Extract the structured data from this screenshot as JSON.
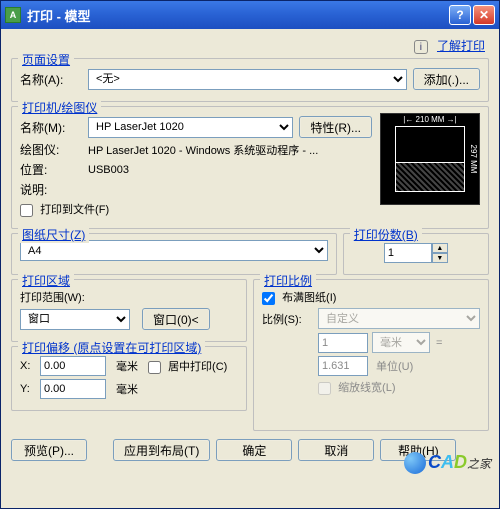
{
  "window": {
    "title": "打印 - 模型"
  },
  "help": {
    "info_icon": "i",
    "link": "了解打印"
  },
  "page_setup": {
    "legend": "页面设置",
    "name_label": "名称(A):",
    "name_value": "<无>",
    "add_btn": "添加(.)..."
  },
  "printer": {
    "legend": "打印机/绘图仪",
    "name_label": "名称(M):",
    "name_value": "HP LaserJet 1020",
    "props_btn": "特性(R)...",
    "plotter_label": "绘图仪:",
    "plotter_value": "HP LaserJet 1020 - Windows 系统驱动程序 - ...",
    "where_label": "位置:",
    "where_value": "USB003",
    "desc_label": "说明:",
    "desc_value": "",
    "print_to_file": "打印到文件(F)",
    "preview": {
      "width": "210 MM",
      "height": "297 MM"
    }
  },
  "paper": {
    "legend": "图纸尺寸(Z)",
    "value": "A4"
  },
  "copies": {
    "legend": "打印份数(B)",
    "value": "1"
  },
  "area": {
    "legend": "打印区域",
    "range_label": "打印范围(W):",
    "range_value": "窗口",
    "window_btn": "窗口(0)<"
  },
  "offset": {
    "legend": "打印偏移 (原点设置在可打印区域)",
    "x_label": "X:",
    "x_value": "0.00",
    "y_label": "Y:",
    "y_value": "0.00",
    "unit": "毫米",
    "center": "居中打印(C)"
  },
  "scale": {
    "legend": "打印比例",
    "fit": "布满图纸(I)",
    "ratio_label": "比例(S):",
    "ratio_value": "自定义",
    "num": "1",
    "num_unit": "毫米",
    "eq": "=",
    "den": "1.631",
    "den_unit": "单位(U)",
    "lw": "缩放线宽(L)"
  },
  "buttons": {
    "preview": "预览(P)...",
    "apply": "应用到布局(T)",
    "ok": "确定",
    "cancel": "取消",
    "help": "帮助(H)"
  },
  "watermark": {
    "c": "C",
    "a": "A",
    "d": "D",
    "rest": "之家"
  }
}
